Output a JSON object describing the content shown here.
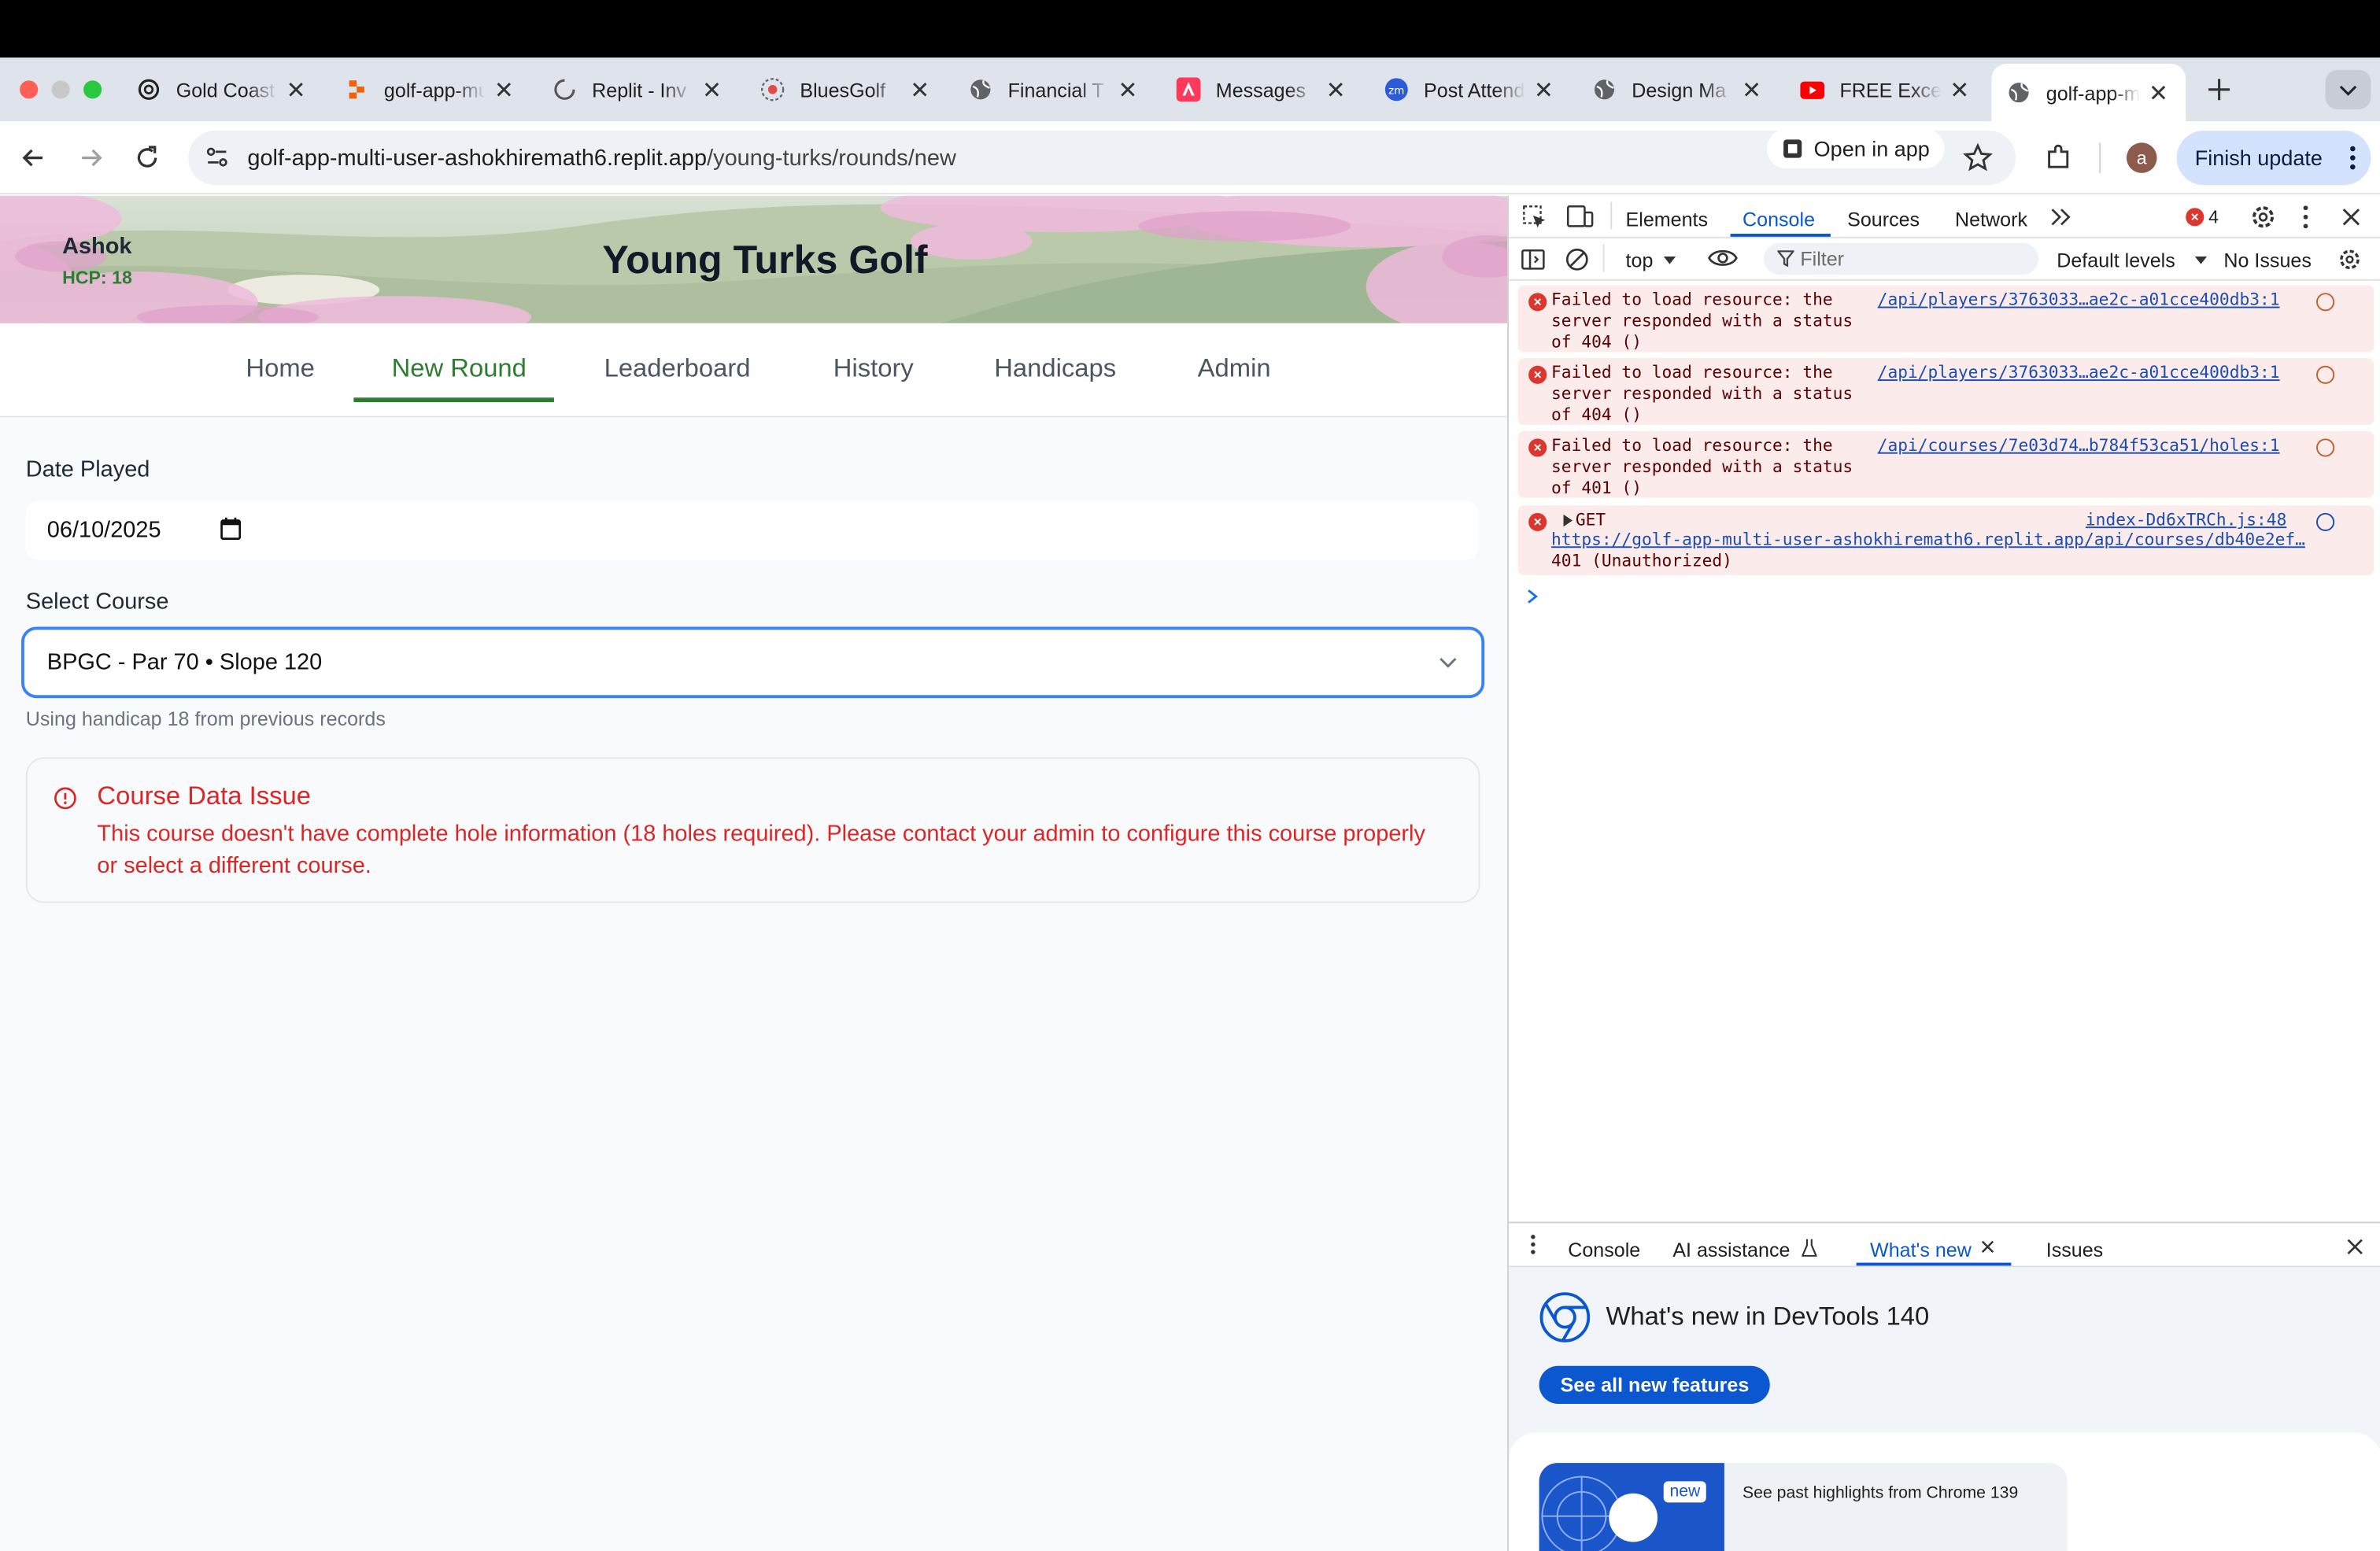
{
  "browser": {
    "tabs": [
      {
        "title": "Gold Coast",
        "icon": "openai-icon"
      },
      {
        "title": "golf-app-multi",
        "icon": "replit-icon"
      },
      {
        "title": "Replit - Inv",
        "icon": "loading-icon"
      },
      {
        "title": "BluesGolf",
        "icon": "bluesgolf-icon"
      },
      {
        "title": "Financial T",
        "icon": "globe-icon"
      },
      {
        "title": "Messages",
        "icon": "airbnb-icon"
      },
      {
        "title": "Post Attend",
        "icon": "zoom-icon"
      },
      {
        "title": "Design Ma",
        "icon": "globe-icon"
      },
      {
        "title": "FREE Exce",
        "icon": "youtube-icon"
      },
      {
        "title": "golf-app-m",
        "icon": "globe-icon"
      }
    ],
    "url_host": "golf-app-multi-user-ashokhiremath6.replit.app",
    "url_path": "/young-turks/rounds/new",
    "open_in_app": "Open in app",
    "finish_update": "Finish update",
    "profile_initial": "a"
  },
  "app": {
    "user_name": "Ashok",
    "user_hcp": "HCP: 18",
    "title": "Young Turks Golf",
    "nav": [
      "Home",
      "New Round",
      "Leaderboard",
      "History",
      "Handicaps",
      "Admin"
    ],
    "active_nav": "New Round",
    "date_label": "Date Played",
    "date_value": "06/10/2025",
    "course_label": "Select Course",
    "course_value": "BPGC - Par 70 • Slope 120",
    "handicap_note": "Using handicap 18 from previous records",
    "alert_title": "Course Data Issue",
    "alert_body": "This course doesn't have complete hole information (18 holes required). Please contact your admin to configure this course properly or select a different course.",
    "colors": {
      "accent": "#2e7d32",
      "error": "#dc2626",
      "focus": "#3b82f6"
    }
  },
  "devtools": {
    "tabs": [
      "Elements",
      "Console",
      "Sources",
      "Network"
    ],
    "active_tab": "Console",
    "error_count": "4",
    "context": "top",
    "filter_placeholder": "Filter",
    "levels": "Default levels",
    "issues": "No Issues",
    "messages": [
      {
        "text": "Failed to load resource: the\nserver responded with a status\nof 404 ()",
        "source": "/api/players/3763033…ae2c-a01cce400db3:1"
      },
      {
        "text": "Failed to load resource: the\nserver responded with a status\nof 404 ()",
        "source": "/api/players/3763033…ae2c-a01cce400db3:1"
      },
      {
        "text": "Failed to load resource: the\nserver responded with a status\nof 401 ()",
        "source": "/api/courses/7e03d74…b784f53ca51/holes:1"
      }
    ],
    "get_message": {
      "method": "GET",
      "source": "index-Dd6xTRCh.js:48",
      "url": "https://golf-app-multi-user-ashokhiremath6.replit.app/api/courses/db40e2ef…",
      "status": "401 (Unauthorized)"
    },
    "drawer": {
      "tabs": [
        "Console",
        "AI assistance",
        "What's new",
        "Issues"
      ],
      "active_tab": "What's new",
      "heading": "What's new in DevTools 140",
      "button": "See all new features",
      "badge": "new",
      "highlight": "See past highlights from Chrome 139"
    }
  }
}
